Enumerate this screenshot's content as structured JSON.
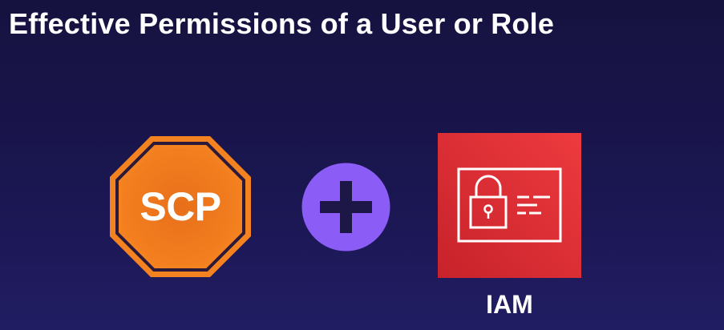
{
  "slide": {
    "title": "Effective Permissions of a User or Role"
  },
  "scp": {
    "label": "SCP",
    "icon": "stop-sign-octagon",
    "color": "#f58025"
  },
  "operator": {
    "icon": "plus-icon",
    "color": "#8b5cf6"
  },
  "iam": {
    "label": "IAM",
    "icon": "padlock-id-card",
    "color": "#d92b2f"
  }
}
